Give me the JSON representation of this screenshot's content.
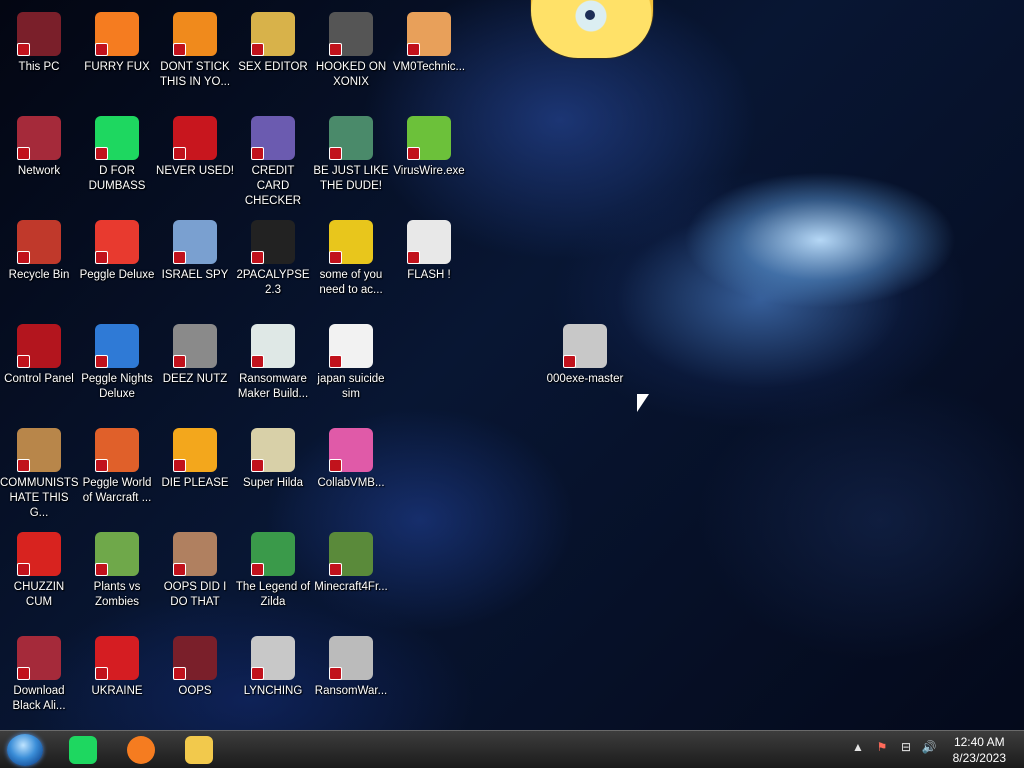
{
  "desktop": {
    "icons": [
      {
        "label": "This PC",
        "icon": "computer-icon",
        "color": "#7a1f2a"
      },
      {
        "label": "Network",
        "icon": "network-icon",
        "color": "#a52a3a"
      },
      {
        "label": "Recycle Bin",
        "icon": "recycle-bin-icon",
        "color": "#c0392b"
      },
      {
        "label": "Control Panel",
        "icon": "control-panel-icon",
        "color": "#b3151e"
      },
      {
        "label": "COMMUNISTS HATE THIS G...",
        "icon": "money-bag-icon",
        "color": "#b8864a"
      },
      {
        "label": "CHUZZIN CUM",
        "icon": "chuzzle-icon",
        "color": "#d8231f"
      },
      {
        "label": "Download Black Ali...",
        "icon": "download-icon",
        "color": "#a52a3a"
      },
      {
        "label": "FURRY FUX",
        "icon": "firefox-icon",
        "color": "#f57c20"
      },
      {
        "label": "D FOR DUMBASS",
        "icon": "spotify-icon",
        "color": "#1ed760"
      },
      {
        "label": "Peggle Deluxe",
        "icon": "peggle-icon",
        "color": "#e83a2f"
      },
      {
        "label": "Peggle Nights Deluxe",
        "icon": "peggle-nights-icon",
        "color": "#2f7ad6"
      },
      {
        "label": "Peggle World of Warcraft ...",
        "icon": "peggle-wow-icon",
        "color": "#e0602a"
      },
      {
        "label": "Plants vs Zombies",
        "icon": "flower-icon",
        "color": "#6fa84a"
      },
      {
        "label": "UKRAINE",
        "icon": "radiation-icon",
        "color": "#d51d22"
      },
      {
        "label": "DONT STICK THIS IN YO...",
        "icon": "vlc-cone-icon",
        "color": "#f08a1c"
      },
      {
        "label": "NEVER USED!",
        "icon": "devcpp-icon",
        "color": "#c8161e"
      },
      {
        "label": "ISRAEL SPY",
        "icon": "network-spy-icon",
        "color": "#7aa0d0"
      },
      {
        "label": "DEEZ NUTZ",
        "icon": "window-stack-icon",
        "color": "#8a8a8a"
      },
      {
        "label": "DIE PLEASE",
        "icon": "adobe-de-icon",
        "color": "#f3a71c"
      },
      {
        "label": "OOPS DID I DO THAT",
        "icon": "portrait-icon",
        "color": "#b08060"
      },
      {
        "label": "OOPS",
        "icon": "book-icon",
        "color": "#7a1f2a"
      },
      {
        "label": "SEX EDITOR",
        "icon": "hxd-icon",
        "color": "#d8b24a"
      },
      {
        "label": "CREDIT CARD CHECKER",
        "icon": "credit-card-icon",
        "color": "#6b5bb0"
      },
      {
        "label": "2PACALYPSE 2.3",
        "icon": "terminal-icon",
        "color": "#222222"
      },
      {
        "label": "Ransomware Maker Build...",
        "icon": "app-window-icon",
        "color": "#dfe8e6"
      },
      {
        "label": "Super Hilda",
        "icon": "pixel-character-icon",
        "color": "#d8d0a8"
      },
      {
        "label": "The Legend of Zilda",
        "icon": "link-character-icon",
        "color": "#3a9a4a"
      },
      {
        "label": "LYNCHING",
        "icon": "noose-icon",
        "color": "#c8c8c8"
      },
      {
        "label": "HOOKED ON XONIX",
        "icon": "xonix-icon",
        "color": "#555555"
      },
      {
        "label": "BE JUST LIKE THE DUDE!",
        "icon": "elf-icon",
        "color": "#4a8a6a"
      },
      {
        "label": "some of you need to ac...",
        "icon": "dog-icon",
        "color": "#e8c61c"
      },
      {
        "label": "japan suicide sim",
        "icon": "document-icon",
        "color": "#f2f2f2"
      },
      {
        "label": "CollabVMB...",
        "icon": "monitor-icon",
        "color": "#e05aa8"
      },
      {
        "label": "Minecraft4Fr...",
        "icon": "grass-block-icon",
        "color": "#5a8a3a"
      },
      {
        "label": "RansomWar...",
        "icon": "skull-icon",
        "color": "#bbbbbb"
      },
      {
        "label": "VM0Technic...",
        "icon": "doctor-icon",
        "color": "#e8a05a"
      },
      {
        "label": "VirusWire.exe",
        "icon": "limewire-icon",
        "color": "#6cc13a"
      },
      {
        "label": "FLASH !",
        "icon": "flash-icon",
        "color": "#e8e8e8"
      },
      {
        "label": "000exe-master",
        "icon": "folder-archive-icon",
        "color": "#c8c8c8"
      }
    ]
  },
  "taskbar": {
    "start_icon": "start-orb-icon",
    "pinned": [
      {
        "icon": "spotify-icon",
        "color": "#1ed760"
      },
      {
        "icon": "firefox-icon",
        "color": "#f57c20"
      },
      {
        "icon": "file-explorer-icon",
        "color": "#f2c94c"
      }
    ],
    "tray": {
      "chevron": "▲",
      "flag": "⚑",
      "network": "⊟",
      "volume": "🔊"
    },
    "clock": {
      "time": "12:40 AM",
      "date": "8/23/2023"
    }
  }
}
